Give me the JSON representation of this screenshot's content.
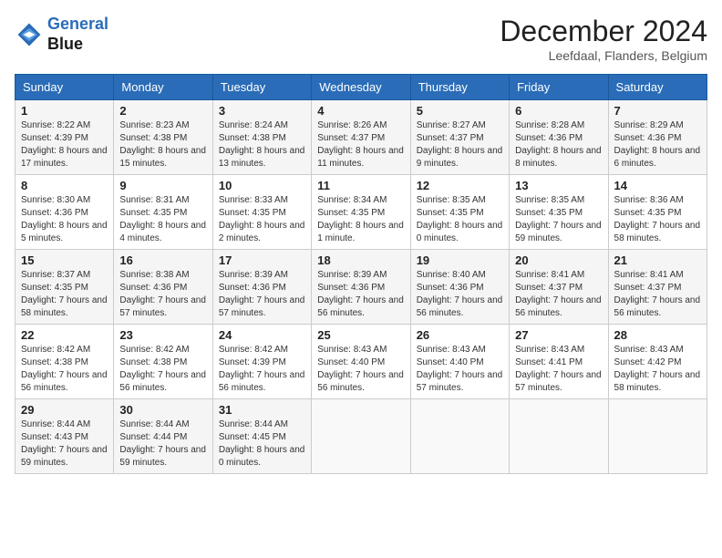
{
  "header": {
    "logo_line1": "General",
    "logo_line2": "Blue",
    "month": "December 2024",
    "location": "Leefdaal, Flanders, Belgium"
  },
  "days_of_week": [
    "Sunday",
    "Monday",
    "Tuesday",
    "Wednesday",
    "Thursday",
    "Friday",
    "Saturday"
  ],
  "weeks": [
    [
      {
        "day": "1",
        "info": "Sunrise: 8:22 AM\nSunset: 4:39 PM\nDaylight: 8 hours and 17 minutes."
      },
      {
        "day": "2",
        "info": "Sunrise: 8:23 AM\nSunset: 4:38 PM\nDaylight: 8 hours and 15 minutes."
      },
      {
        "day": "3",
        "info": "Sunrise: 8:24 AM\nSunset: 4:38 PM\nDaylight: 8 hours and 13 minutes."
      },
      {
        "day": "4",
        "info": "Sunrise: 8:26 AM\nSunset: 4:37 PM\nDaylight: 8 hours and 11 minutes."
      },
      {
        "day": "5",
        "info": "Sunrise: 8:27 AM\nSunset: 4:37 PM\nDaylight: 8 hours and 9 minutes."
      },
      {
        "day": "6",
        "info": "Sunrise: 8:28 AM\nSunset: 4:36 PM\nDaylight: 8 hours and 8 minutes."
      },
      {
        "day": "7",
        "info": "Sunrise: 8:29 AM\nSunset: 4:36 PM\nDaylight: 8 hours and 6 minutes."
      }
    ],
    [
      {
        "day": "8",
        "info": "Sunrise: 8:30 AM\nSunset: 4:36 PM\nDaylight: 8 hours and 5 minutes."
      },
      {
        "day": "9",
        "info": "Sunrise: 8:31 AM\nSunset: 4:35 PM\nDaylight: 8 hours and 4 minutes."
      },
      {
        "day": "10",
        "info": "Sunrise: 8:33 AM\nSunset: 4:35 PM\nDaylight: 8 hours and 2 minutes."
      },
      {
        "day": "11",
        "info": "Sunrise: 8:34 AM\nSunset: 4:35 PM\nDaylight: 8 hours and 1 minute."
      },
      {
        "day": "12",
        "info": "Sunrise: 8:35 AM\nSunset: 4:35 PM\nDaylight: 8 hours and 0 minutes."
      },
      {
        "day": "13",
        "info": "Sunrise: 8:35 AM\nSunset: 4:35 PM\nDaylight: 7 hours and 59 minutes."
      },
      {
        "day": "14",
        "info": "Sunrise: 8:36 AM\nSunset: 4:35 PM\nDaylight: 7 hours and 58 minutes."
      }
    ],
    [
      {
        "day": "15",
        "info": "Sunrise: 8:37 AM\nSunset: 4:35 PM\nDaylight: 7 hours and 58 minutes."
      },
      {
        "day": "16",
        "info": "Sunrise: 8:38 AM\nSunset: 4:36 PM\nDaylight: 7 hours and 57 minutes."
      },
      {
        "day": "17",
        "info": "Sunrise: 8:39 AM\nSunset: 4:36 PM\nDaylight: 7 hours and 57 minutes."
      },
      {
        "day": "18",
        "info": "Sunrise: 8:39 AM\nSunset: 4:36 PM\nDaylight: 7 hours and 56 minutes."
      },
      {
        "day": "19",
        "info": "Sunrise: 8:40 AM\nSunset: 4:36 PM\nDaylight: 7 hours and 56 minutes."
      },
      {
        "day": "20",
        "info": "Sunrise: 8:41 AM\nSunset: 4:37 PM\nDaylight: 7 hours and 56 minutes."
      },
      {
        "day": "21",
        "info": "Sunrise: 8:41 AM\nSunset: 4:37 PM\nDaylight: 7 hours and 56 minutes."
      }
    ],
    [
      {
        "day": "22",
        "info": "Sunrise: 8:42 AM\nSunset: 4:38 PM\nDaylight: 7 hours and 56 minutes."
      },
      {
        "day": "23",
        "info": "Sunrise: 8:42 AM\nSunset: 4:38 PM\nDaylight: 7 hours and 56 minutes."
      },
      {
        "day": "24",
        "info": "Sunrise: 8:42 AM\nSunset: 4:39 PM\nDaylight: 7 hours and 56 minutes."
      },
      {
        "day": "25",
        "info": "Sunrise: 8:43 AM\nSunset: 4:40 PM\nDaylight: 7 hours and 56 minutes."
      },
      {
        "day": "26",
        "info": "Sunrise: 8:43 AM\nSunset: 4:40 PM\nDaylight: 7 hours and 57 minutes."
      },
      {
        "day": "27",
        "info": "Sunrise: 8:43 AM\nSunset: 4:41 PM\nDaylight: 7 hours and 57 minutes."
      },
      {
        "day": "28",
        "info": "Sunrise: 8:43 AM\nSunset: 4:42 PM\nDaylight: 7 hours and 58 minutes."
      }
    ],
    [
      {
        "day": "29",
        "info": "Sunrise: 8:44 AM\nSunset: 4:43 PM\nDaylight: 7 hours and 59 minutes."
      },
      {
        "day": "30",
        "info": "Sunrise: 8:44 AM\nSunset: 4:44 PM\nDaylight: 7 hours and 59 minutes."
      },
      {
        "day": "31",
        "info": "Sunrise: 8:44 AM\nSunset: 4:45 PM\nDaylight: 8 hours and 0 minutes."
      },
      null,
      null,
      null,
      null
    ]
  ]
}
